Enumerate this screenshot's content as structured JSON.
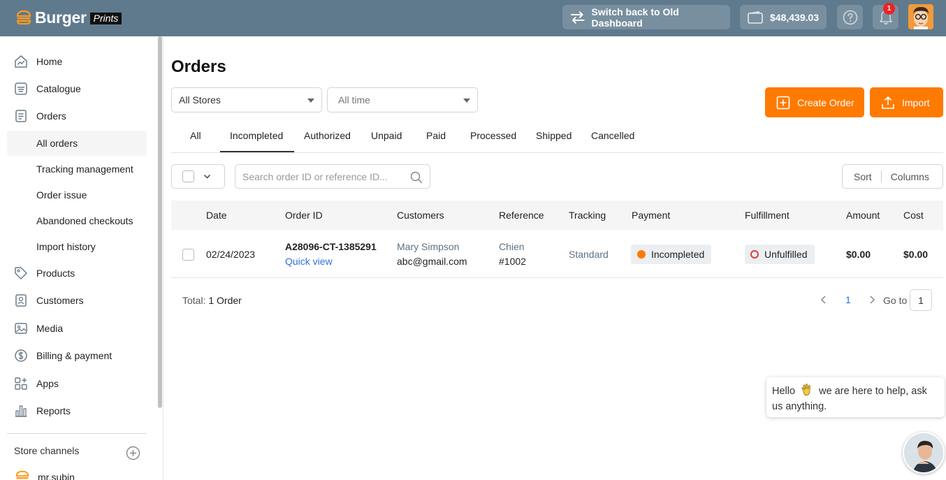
{
  "header": {
    "logo_word": "Burger",
    "logo_sub": "Prints",
    "switch_label": "Switch back to Old Dashboard",
    "balance": "$48,439.03",
    "notification_count": "1",
    "accent_color": "#ff7a00",
    "bar_color": "#5f7a8d"
  },
  "sidebar": {
    "items": [
      {
        "label": "Home",
        "icon": "home-chart-icon"
      },
      {
        "label": "Catalogue",
        "icon": "catalogue-icon"
      },
      {
        "label": "Orders",
        "icon": "orders-icon"
      },
      {
        "label": "Products",
        "icon": "tag-icon"
      },
      {
        "label": "Customers",
        "icon": "customer-icon"
      },
      {
        "label": "Media",
        "icon": "image-icon"
      },
      {
        "label": "Billing & payment",
        "icon": "dollar-icon"
      },
      {
        "label": "Apps",
        "icon": "apps-icon"
      },
      {
        "label": "Reports",
        "icon": "bar-chart-icon"
      }
    ],
    "order_subitems": [
      "All orders",
      "Tracking management",
      "Order issue",
      "Abandoned checkouts",
      "Import history"
    ],
    "store_channels_label": "Store channels",
    "store_name": "mr.subin"
  },
  "main": {
    "title": "Orders",
    "store_filter": "All Stores",
    "time_filter": "All time",
    "create_label": "Create Order",
    "import_label": "Import",
    "tabs": [
      "All",
      "Incompleted",
      "Authorized",
      "Unpaid",
      "Paid",
      "Processed",
      "Shipped",
      "Cancelled"
    ],
    "active_tab": "Incompleted",
    "search_placeholder": "Search order ID or reference ID...",
    "sort_label": "Sort",
    "columns_label": "Columns",
    "table": {
      "headers": [
        "Date",
        "Order ID",
        "Customers",
        "Reference",
        "Tracking",
        "Payment",
        "Fulfillment",
        "Amount",
        "Cost"
      ],
      "rows": [
        {
          "date": "02/24/2023",
          "order_id": "A28096-CT-1385291",
          "quick_view": "Quick view",
          "customer_name": "Mary Simpson",
          "customer_email": "abc@gmail.com",
          "reference_name": "Chien",
          "reference_num": "#1002",
          "tracking": "Standard",
          "payment": "Incompleted",
          "fulfillment": "Unfulfilled",
          "amount": "$0.00",
          "cost": "$0.00"
        }
      ]
    },
    "total_label": "Total:",
    "total_value": "1 Order",
    "current_page": "1",
    "goto_label": "Go to",
    "goto_value": "1"
  },
  "chat": {
    "message_before": "Hello",
    "message_after": "we are here to help, ask us anything."
  }
}
